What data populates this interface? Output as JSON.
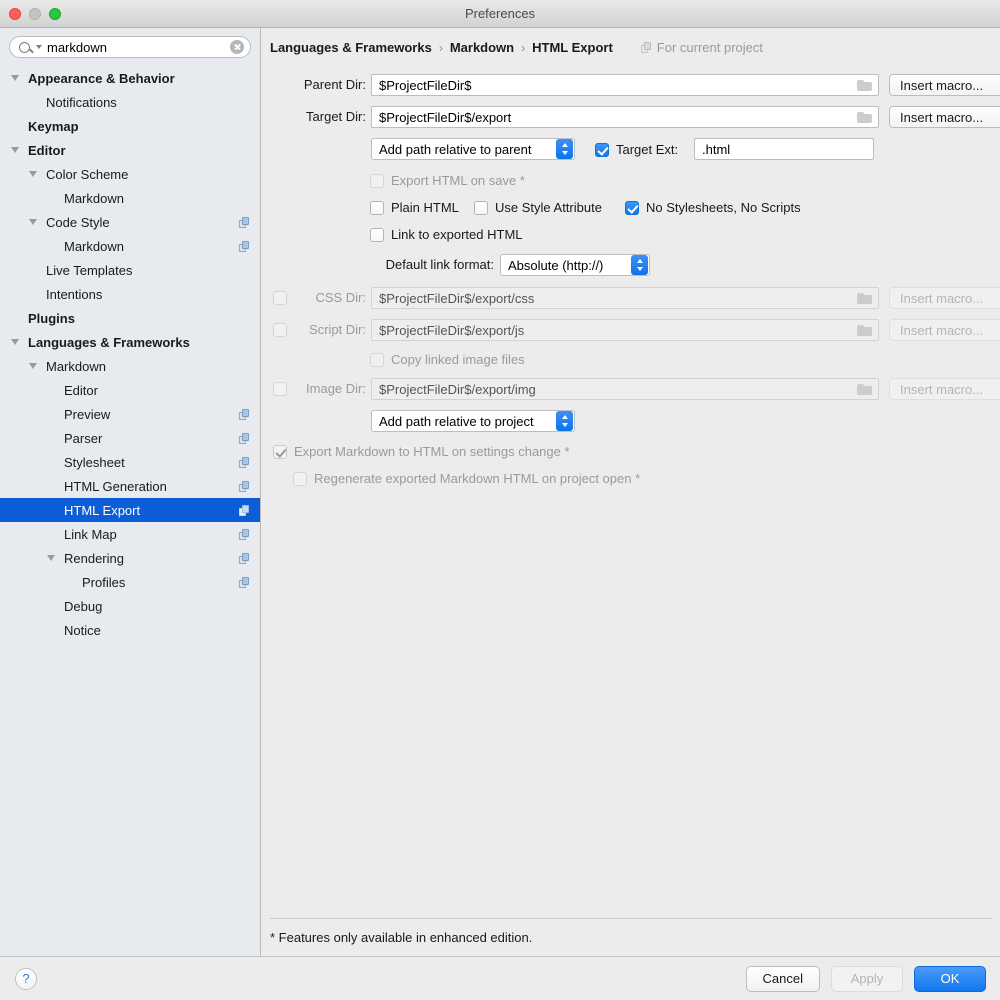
{
  "window": {
    "title": "Preferences"
  },
  "search": {
    "value": "markdown",
    "placeholder": ""
  },
  "sidebar": {
    "items": [
      {
        "label": "Appearance & Behavior",
        "indent": 28,
        "bold": true,
        "twisty": true,
        "copy": false,
        "selected": false
      },
      {
        "label": "Notifications",
        "indent": 46,
        "bold": false,
        "twisty": false,
        "copy": false,
        "selected": false
      },
      {
        "label": "Keymap",
        "indent": 28,
        "bold": true,
        "twisty": false,
        "copy": false,
        "selected": false
      },
      {
        "label": "Editor",
        "indent": 28,
        "bold": true,
        "twisty": true,
        "copy": false,
        "selected": false
      },
      {
        "label": "Color Scheme",
        "indent": 46,
        "bold": false,
        "twisty": true,
        "copy": false,
        "selected": false
      },
      {
        "label": "Markdown",
        "indent": 64,
        "bold": false,
        "twisty": false,
        "copy": false,
        "selected": false
      },
      {
        "label": "Code Style",
        "indent": 46,
        "bold": false,
        "twisty": true,
        "copy": true,
        "selected": false
      },
      {
        "label": "Markdown",
        "indent": 64,
        "bold": false,
        "twisty": false,
        "copy": true,
        "selected": false
      },
      {
        "label": "Live Templates",
        "indent": 46,
        "bold": false,
        "twisty": false,
        "copy": false,
        "selected": false
      },
      {
        "label": "Intentions",
        "indent": 46,
        "bold": false,
        "twisty": false,
        "copy": false,
        "selected": false
      },
      {
        "label": "Plugins",
        "indent": 28,
        "bold": true,
        "twisty": false,
        "copy": false,
        "selected": false
      },
      {
        "label": "Languages & Frameworks",
        "indent": 28,
        "bold": true,
        "twisty": true,
        "copy": false,
        "selected": false
      },
      {
        "label": "Markdown",
        "indent": 46,
        "bold": false,
        "twisty": true,
        "copy": false,
        "selected": false
      },
      {
        "label": "Editor",
        "indent": 64,
        "bold": false,
        "twisty": false,
        "copy": false,
        "selected": false
      },
      {
        "label": "Preview",
        "indent": 64,
        "bold": false,
        "twisty": false,
        "copy": true,
        "selected": false
      },
      {
        "label": "Parser",
        "indent": 64,
        "bold": false,
        "twisty": false,
        "copy": true,
        "selected": false
      },
      {
        "label": "Stylesheet",
        "indent": 64,
        "bold": false,
        "twisty": false,
        "copy": true,
        "selected": false
      },
      {
        "label": "HTML Generation",
        "indent": 64,
        "bold": false,
        "twisty": false,
        "copy": true,
        "selected": false
      },
      {
        "label": "HTML Export",
        "indent": 64,
        "bold": false,
        "twisty": false,
        "copy": true,
        "selected": true
      },
      {
        "label": "Link Map",
        "indent": 64,
        "bold": false,
        "twisty": false,
        "copy": true,
        "selected": false
      },
      {
        "label": "Rendering",
        "indent": 64,
        "bold": false,
        "twisty": true,
        "copy": true,
        "selected": false
      },
      {
        "label": "Profiles",
        "indent": 82,
        "bold": false,
        "twisty": false,
        "copy": true,
        "selected": false
      },
      {
        "label": "Debug",
        "indent": 64,
        "bold": false,
        "twisty": false,
        "copy": false,
        "selected": false
      },
      {
        "label": "Notice",
        "indent": 64,
        "bold": false,
        "twisty": false,
        "copy": false,
        "selected": false
      }
    ]
  },
  "breadcrumb": {
    "crumbs": [
      "Languages & Frameworks",
      "Markdown",
      "HTML Export"
    ],
    "separator": "›",
    "scope_label": "For current project"
  },
  "form": {
    "parent_dir": {
      "label": "Parent Dir:",
      "value": "$ProjectFileDir$"
    },
    "target_dir": {
      "label": "Target Dir:",
      "value": "$ProjectFileDir$/export"
    },
    "css_dir": {
      "label": "CSS Dir:",
      "value": "$ProjectFileDir$/export/css"
    },
    "script_dir": {
      "label": "Script Dir:",
      "value": "$ProjectFileDir$/export/js"
    },
    "image_dir": {
      "label": "Image Dir:",
      "value": "$ProjectFileDir$/export/img"
    },
    "insert_macro_label": "Insert macro...",
    "path_relative_parent": "Add path relative to parent",
    "path_relative_project": "Add path relative to project",
    "default_link_format_label": "Default link format:",
    "default_link_format_value": "Absolute (http://)",
    "target_ext": {
      "label": "Target Ext:",
      "value": ".html",
      "checked": true
    },
    "checkboxes": {
      "export_on_save": {
        "label": "Export HTML on save *",
        "checked": false,
        "disabled": true
      },
      "plain_html": {
        "label": "Plain HTML",
        "checked": false,
        "disabled": false
      },
      "use_style_attribute": {
        "label": "Use Style Attribute",
        "checked": false,
        "disabled": false
      },
      "no_stylesheets": {
        "label": "No Stylesheets, No Scripts",
        "checked": true,
        "disabled": false
      },
      "link_to_exported": {
        "label": "Link to exported HTML",
        "checked": false,
        "disabled": false
      },
      "css_dir": {
        "label": "",
        "checked": false,
        "disabled": true
      },
      "script_dir": {
        "label": "",
        "checked": false,
        "disabled": true
      },
      "copy_linked_images": {
        "label": "Copy linked image files",
        "checked": false,
        "disabled": true
      },
      "image_dir": {
        "label": "",
        "checked": false,
        "disabled": true
      },
      "export_on_settings": {
        "label": "Export Markdown to HTML on settings change *",
        "checked": true,
        "disabled": true
      },
      "regenerate_on_open": {
        "label": "Regenerate exported Markdown HTML on project open *",
        "checked": false,
        "disabled": true
      }
    },
    "footnote": "* Features only available in enhanced edition."
  },
  "footer": {
    "help_label": "?",
    "cancel_label": "Cancel",
    "apply_label": "Apply",
    "ok_label": "OK"
  },
  "colors": {
    "selection": "#0b5ed7",
    "accent": "#0a7cf0",
    "window_bg": "#ececec",
    "sidebar_bg": "#e7ebef"
  }
}
